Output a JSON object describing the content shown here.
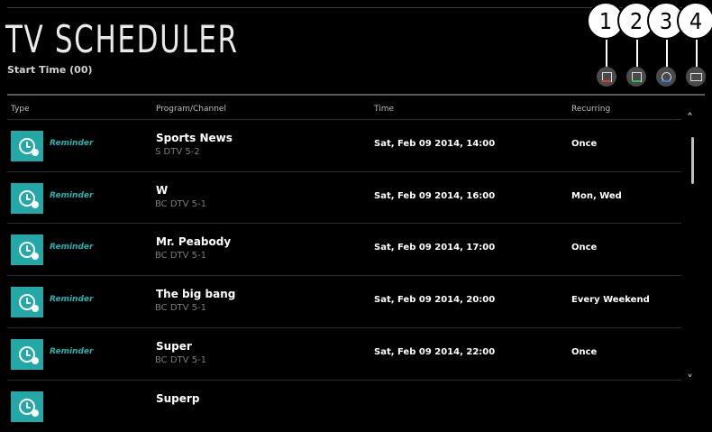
{
  "header": {
    "title": "TV SCHEDULER",
    "subtitle": "Start Time (00)"
  },
  "callouts": [
    "1",
    "2",
    "3",
    "4"
  ],
  "action_buttons": [
    {
      "name": "red",
      "color": "#e03a3a"
    },
    {
      "name": "green",
      "color": "#2fbf4a"
    },
    {
      "name": "blue",
      "color": "#2f7fe0"
    },
    {
      "name": "info",
      "color": "#dddddd"
    }
  ],
  "table": {
    "headers": [
      "Type",
      "Program/Channel",
      "Time",
      "Recurring"
    ],
    "rows": [
      {
        "type": "Reminder",
        "program": "Sports News",
        "channel": "S DTV 5-2",
        "time": "Sat, Feb 09 2014, 14:00",
        "recurring": "Once"
      },
      {
        "type": "Reminder",
        "program": "W",
        "channel": "BC DTV 5-1",
        "time": "Sat, Feb 09 2014, 16:00",
        "recurring": "Mon, Wed"
      },
      {
        "type": "Reminder",
        "program": "Mr. Peabody",
        "channel": "BC DTV 5-1",
        "time": "Sat, Feb 09 2014, 17:00",
        "recurring": "Once"
      },
      {
        "type": "Reminder",
        "program": "The big bang",
        "channel": "BC DTV 5-1",
        "time": "Sat, Feb 09 2014, 20:00",
        "recurring": "Every Weekend"
      },
      {
        "type": "Reminder",
        "program": "Super",
        "channel": "BC DTV 5-1",
        "time": "Sat, Feb 09 2014, 22:00",
        "recurring": "Once"
      },
      {
        "type": "",
        "program": "Superp",
        "channel": "",
        "time": "",
        "recurring": ""
      }
    ]
  },
  "scroll": {
    "up": "˄",
    "down": "˅"
  },
  "accent_color": "#23a7a7"
}
